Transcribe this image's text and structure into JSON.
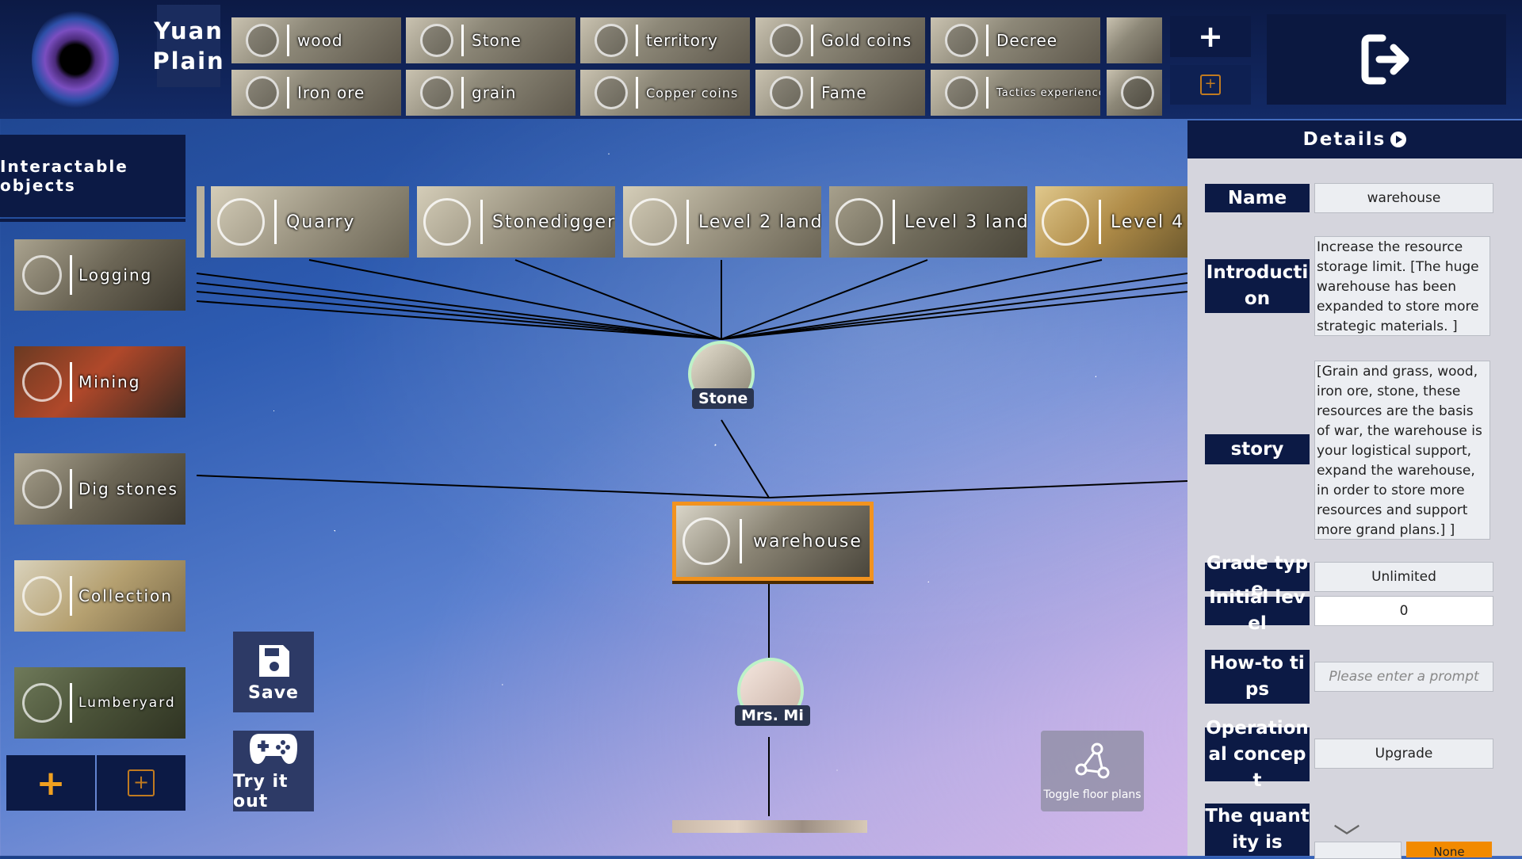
{
  "app": {
    "map_title": "Yuan Plain",
    "exit_icon": "exit-icon",
    "logo_icon": "galaxy-logo-icon"
  },
  "top_resources": {
    "row1": [
      "wood",
      "Stone",
      "territory",
      "Gold coins",
      "Decree"
    ],
    "row2": [
      "Iron ore",
      "grain",
      "Copper coins",
      "Fame",
      "Tactics experience"
    ],
    "add_icon": "plus-icon",
    "paste_icon": "paste-icon"
  },
  "left_panel": {
    "header": "Interactable objects",
    "items": [
      "Logging",
      "Mining",
      "Dig stones",
      "Collection",
      "Lumberyard"
    ],
    "add_icon": "plus-icon",
    "paste_icon": "paste-icon"
  },
  "canvas": {
    "upper_nodes": [
      "Quarry",
      "Stonedigger",
      "Level 2 land",
      "Level 3 land",
      "Level 4"
    ],
    "stone_node": "Stone",
    "selected_node": "warehouse",
    "npc_node": "Mrs. Mi",
    "save_label": "Save",
    "try_label": "Try it out",
    "toggle_label": "Toggle floor plans"
  },
  "details": {
    "title": "Details",
    "name_label": "Name",
    "name_value": "warehouse",
    "intro_label": "Introduction",
    "intro_value": "Increase the resource storage limit. [The huge warehouse has been expanded to store more strategic materials. ]",
    "story_label": "story",
    "story_value": "[Grain and grass, wood, iron ore, stone, these resources are the basis of war, the warehouse is your logistical support, expand the warehouse, in order to store more resources and support more grand plans.] ]",
    "grade_label": "Grade type",
    "grade_value": "Unlimited",
    "initial_label": "Initial level",
    "initial_value": "0",
    "howto_label": "How-to tips",
    "howto_placeholder": "Please enter a prompt",
    "concept_label": "Operational concept",
    "concept_value": "Upgrade",
    "quantity_label": "The quantity is",
    "quantity_button": "None"
  },
  "colors": {
    "accent_orange": "#f2931f",
    "panel_navy": "#0c1a45",
    "node_ring": "#bdf2c8"
  }
}
